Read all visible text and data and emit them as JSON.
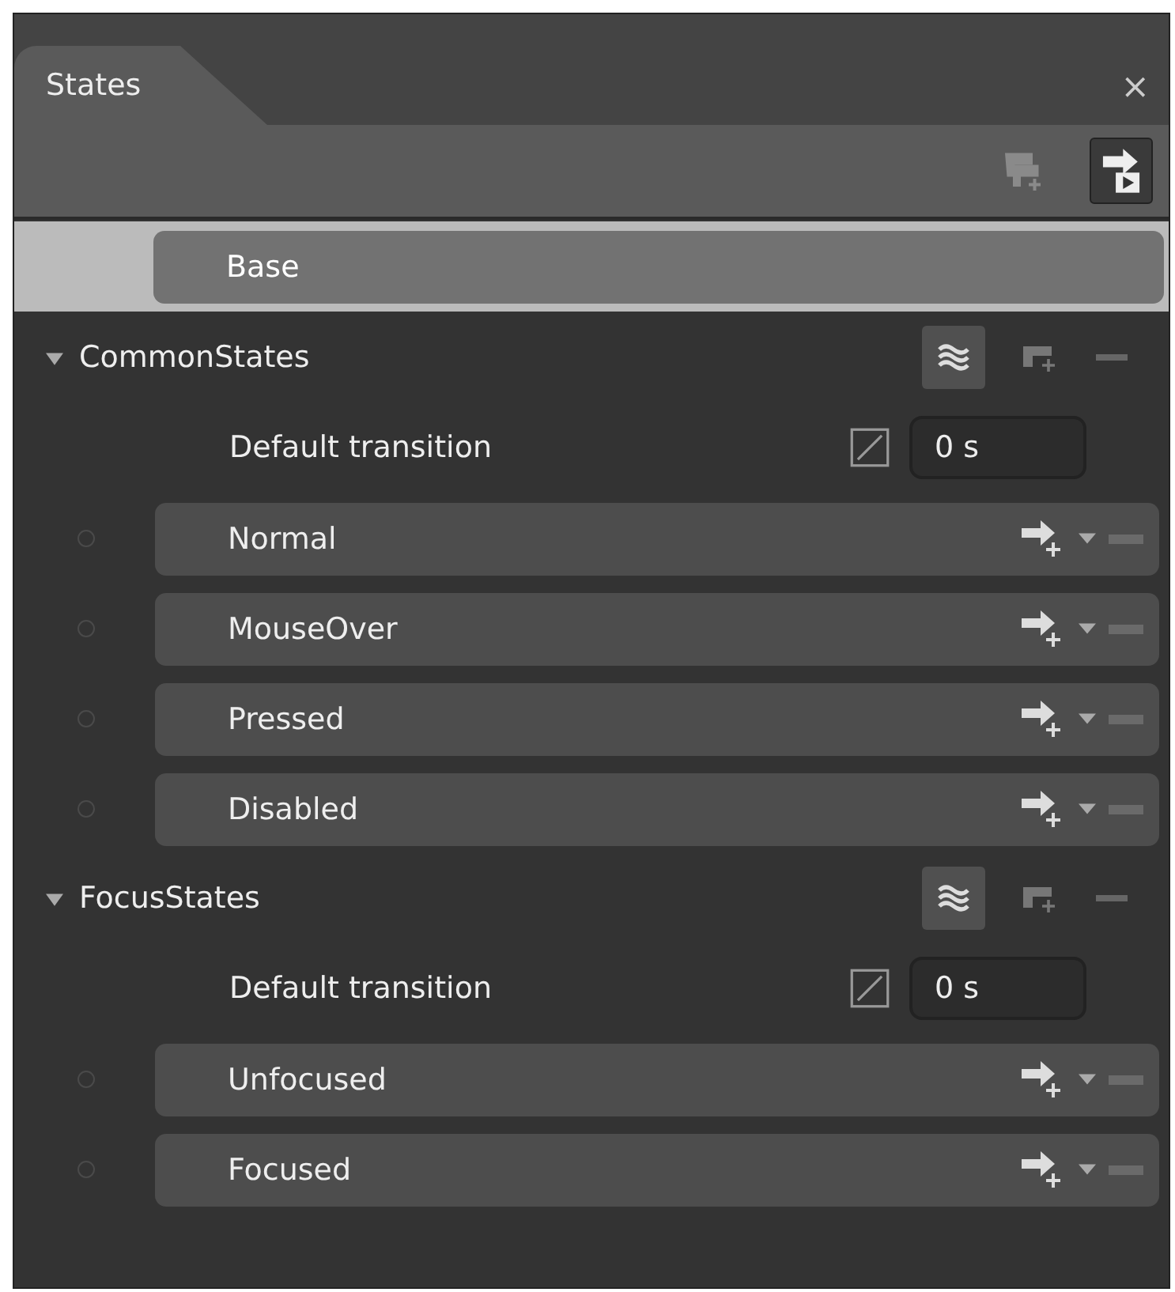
{
  "panel": {
    "title": "States",
    "close": "×"
  },
  "base": {
    "label": "Base",
    "selected": true
  },
  "groups": [
    {
      "name": "CommonStates",
      "expanded": true,
      "transition": {
        "label": "Default transition",
        "value": "0 s"
      },
      "states": [
        {
          "name": "Normal",
          "selected": false
        },
        {
          "name": "MouseOver",
          "selected": false
        },
        {
          "name": "Pressed",
          "selected": false
        },
        {
          "name": "Disabled",
          "selected": false
        }
      ]
    },
    {
      "name": "FocusStates",
      "expanded": true,
      "transition": {
        "label": "Default transition",
        "value": "0 s"
      },
      "states": [
        {
          "name": "Unfocused",
          "selected": false
        },
        {
          "name": "Focused",
          "selected": false
        }
      ]
    }
  ]
}
